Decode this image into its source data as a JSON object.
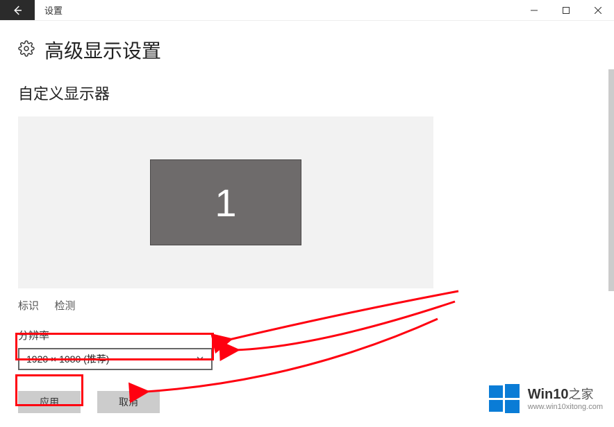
{
  "titlebar": {
    "title": "设置"
  },
  "header": {
    "title": "高级显示设置"
  },
  "custom_display": {
    "heading": "自定义显示器",
    "monitor_number": "1"
  },
  "links": {
    "identify": "标识",
    "detect": "检测"
  },
  "resolution": {
    "label": "分辨率",
    "selected": "1920 × 1080 (推荐)"
  },
  "buttons": {
    "apply": "应用",
    "cancel": "取消"
  },
  "watermark": {
    "line1a": "Win10",
    "line1b": "之家",
    "line2": "www.win10xitong.com"
  }
}
